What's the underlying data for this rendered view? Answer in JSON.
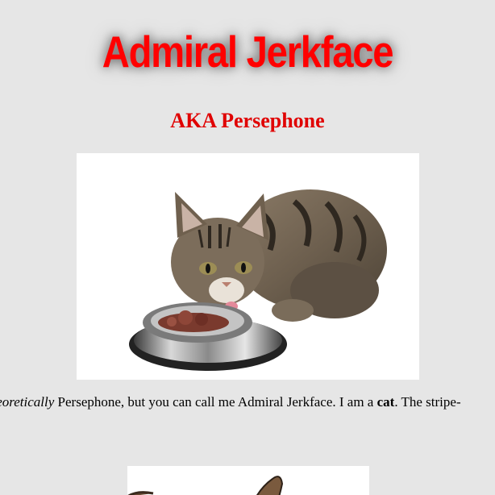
{
  "header": {
    "title": "Admiral Jerkface",
    "subtitle": "AKA Persephone"
  },
  "intro": {
    "lead_italic": "theoretically",
    "part1": " Persephone, but you can call me Admiral Jerkface. I am a ",
    "bold_word": "cat",
    "part2": ". The stripe-"
  },
  "colors": {
    "background": "#e6e6e6",
    "title": "#ff0000",
    "subtitle": "#e00000"
  }
}
